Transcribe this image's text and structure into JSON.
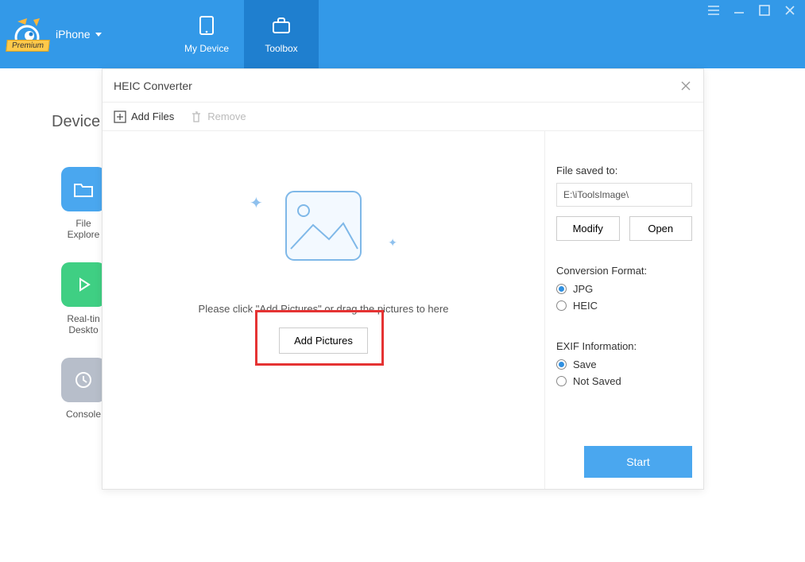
{
  "header": {
    "premium_badge": "Premium",
    "device_label": "iPhone",
    "tabs": [
      {
        "label": "My Device"
      },
      {
        "label": "Toolbox"
      }
    ]
  },
  "sidebar": {
    "heading": "Device",
    "items": [
      {
        "label": "File Explore"
      },
      {
        "label": "Real-tin Deskto"
      },
      {
        "label": "Console"
      }
    ]
  },
  "modal": {
    "title": "HEIC Converter",
    "toolbar": {
      "add_files": "Add Files",
      "remove": "Remove"
    },
    "drop_hint": "Please click \"Add Pictures\" or drag the pictures to here",
    "add_pictures": "Add Pictures",
    "right": {
      "saved_to_label": "File saved to:",
      "saved_to_path": "E:\\iToolsImage\\",
      "modify": "Modify",
      "open": "Open",
      "format_label": "Conversion Format:",
      "format_options": {
        "jpg": "JPG",
        "heic": "HEIC"
      },
      "exif_label": "EXIF Information:",
      "exif_options": {
        "save": "Save",
        "not_saved": "Not Saved"
      },
      "start": "Start"
    }
  }
}
